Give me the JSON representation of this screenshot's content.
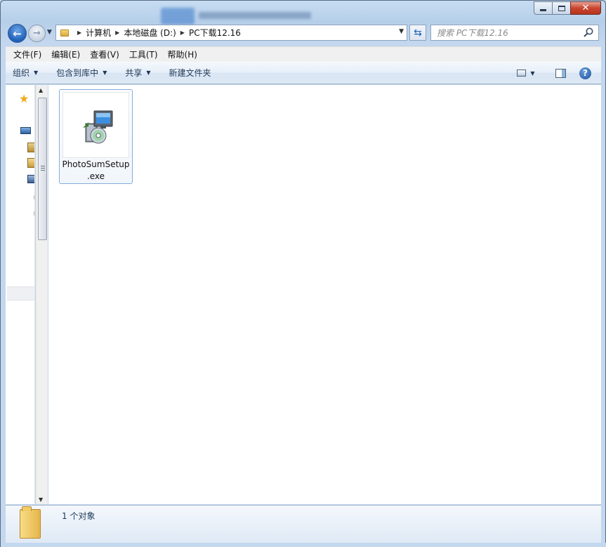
{
  "window": {
    "caption": {
      "minimize": "minimize",
      "maximize": "maximize",
      "close": "✕"
    }
  },
  "nav": {
    "back_glyph": "←",
    "forward_glyph": "→",
    "breadcrumbs": [
      "计算机",
      "本地磁盘 (D:)",
      "PC下载12.16"
    ],
    "refresh_glyph": "⇆"
  },
  "search": {
    "placeholder": "搜索 PC下载12.16"
  },
  "menubar": {
    "items": [
      "文件(F)",
      "编辑(E)",
      "查看(V)",
      "工具(T)",
      "帮助(H)"
    ]
  },
  "commandbar": {
    "organize": "组织",
    "include_in_library": "包含到库中",
    "share": "共享",
    "new_folder": "新建文件夹",
    "help": "?"
  },
  "content": {
    "files": [
      {
        "name": "PhotoSumSetup.exe",
        "icon": "installer-icon"
      }
    ]
  },
  "status": {
    "item_count": "1 个对象"
  },
  "colors": {
    "frame": "#c3d7ee",
    "accent": "#1f5fb8",
    "selection_border": "#84acdd",
    "close_red": "#c9452f"
  }
}
